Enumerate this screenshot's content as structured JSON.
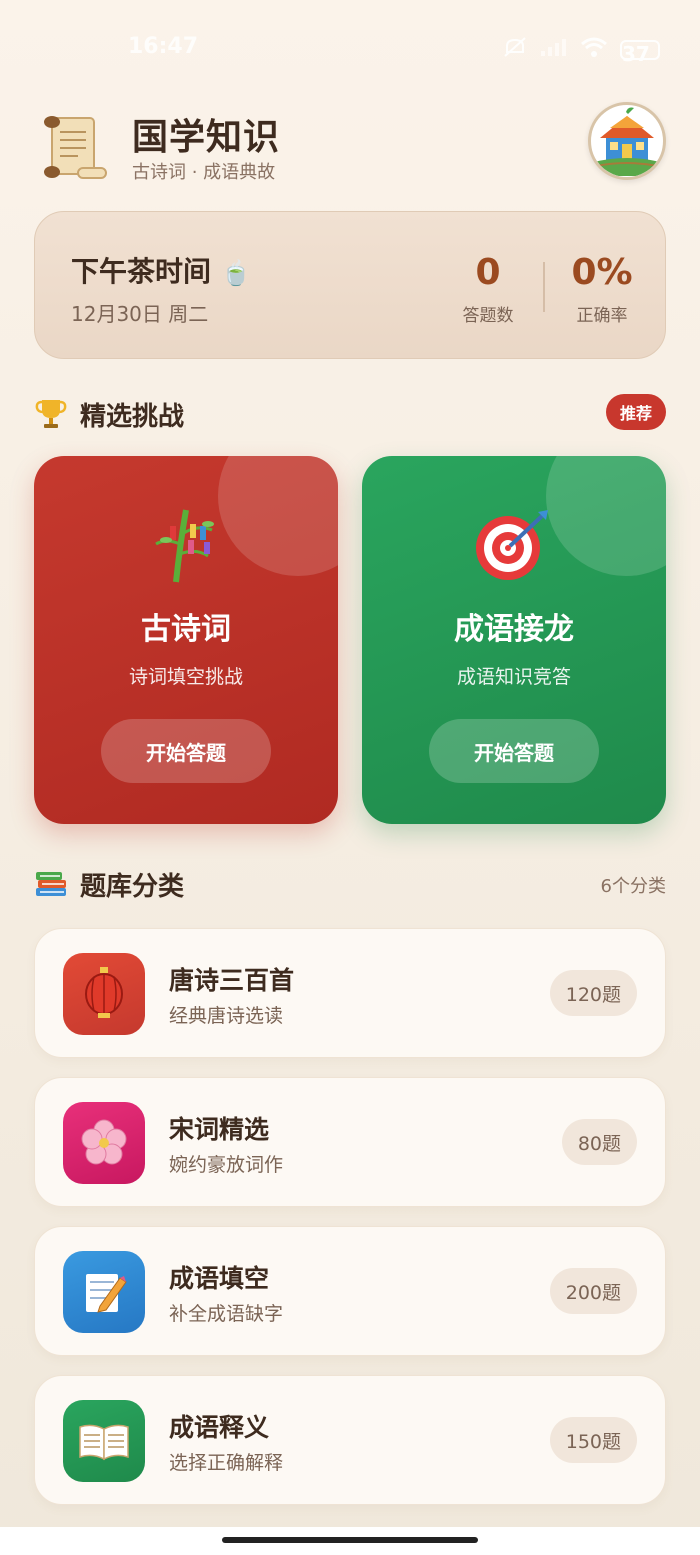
{
  "status_bar": {
    "time": "16:47",
    "battery": "37"
  },
  "header": {
    "title": "国学知识",
    "subtitle": "古诗词 · 成语典故"
  },
  "stats": {
    "greeting": "下午茶时间",
    "date": "12月30日 周二",
    "answered_value": "0",
    "answered_label": "答题数",
    "accuracy_value": "0%",
    "accuracy_label": "正确率"
  },
  "featured": {
    "title": "精选挑战",
    "badge": "推荐",
    "cards": [
      {
        "title": "古诗词",
        "desc": "诗词填空挑战",
        "button": "开始答题",
        "color": "#c5392e",
        "icon": "tanabata-tree-icon"
      },
      {
        "title": "成语接龙",
        "desc": "成语知识竞答",
        "button": "开始答题",
        "color": "#2aa55e",
        "icon": "target-icon"
      }
    ]
  },
  "categories": {
    "title": "题库分类",
    "count": "6个分类",
    "items": [
      {
        "title": "唐诗三百首",
        "desc": "经典唐诗选读",
        "count": "120题",
        "color": "#d6402f",
        "icon": "lantern-icon"
      },
      {
        "title": "宋词精选",
        "desc": "婉约豪放词作",
        "count": "80题",
        "color": "#d8206a",
        "icon": "blossom-icon"
      },
      {
        "title": "成语填空",
        "desc": "补全成语缺字",
        "count": "200题",
        "color": "#2f8fd6",
        "icon": "memo-icon"
      },
      {
        "title": "成语释义",
        "desc": "选择正确解释",
        "count": "150题",
        "color": "#23964f",
        "icon": "open-book-icon"
      }
    ]
  }
}
